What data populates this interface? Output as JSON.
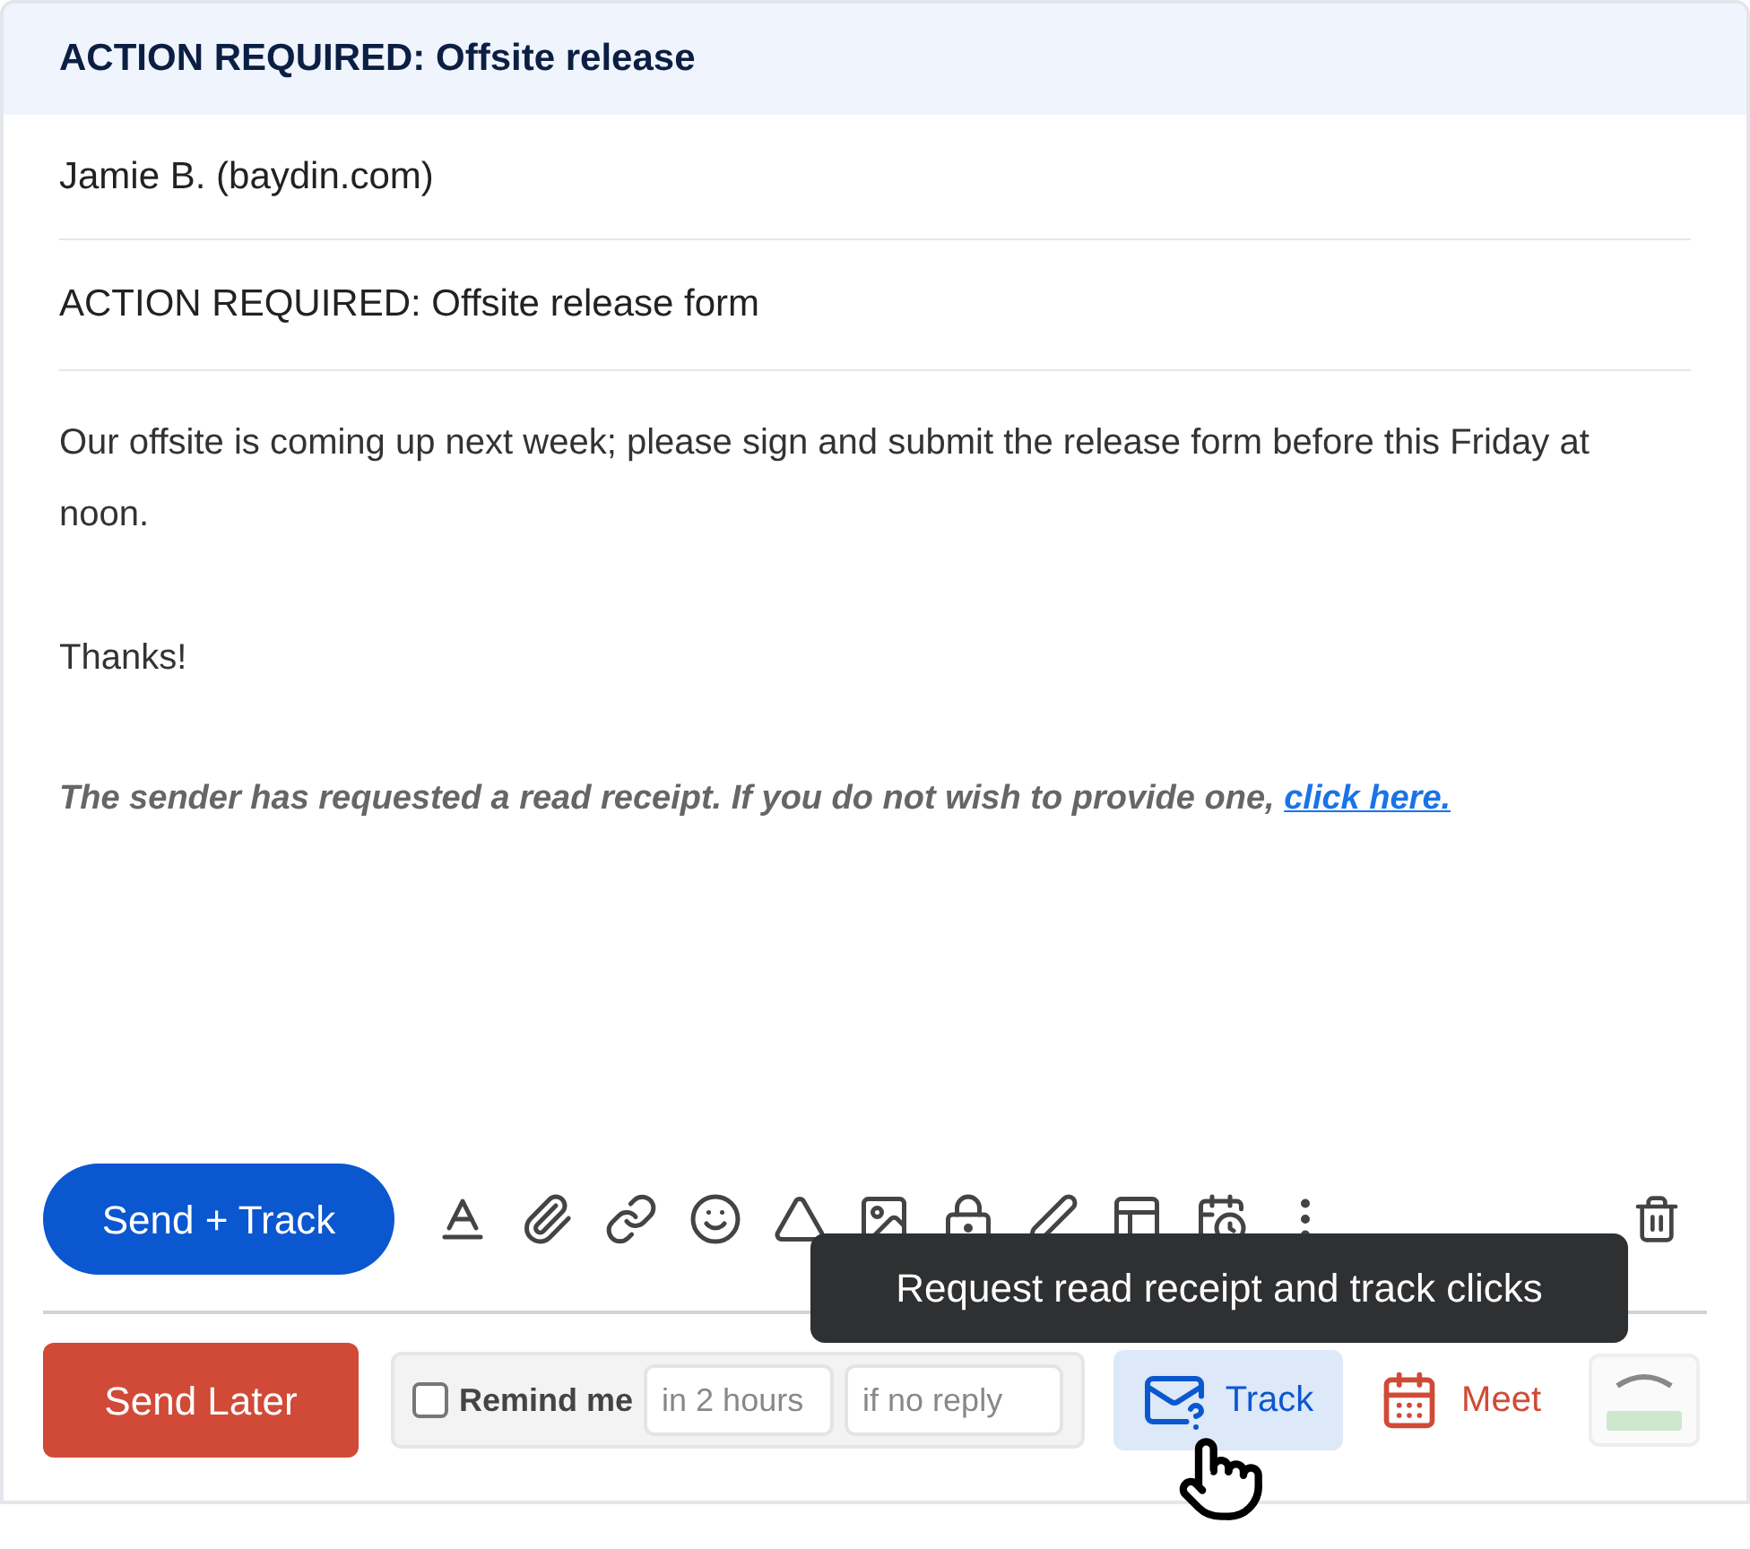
{
  "header": {
    "title": "ACTION REQUIRED: Offsite release"
  },
  "recipient": "Jamie B. (baydin.com)",
  "subject": "ACTION REQUIRED: Offsite release form",
  "body": {
    "paragraphs": [
      "Our offsite is coming up next week; please sign and submit the release form before this Friday at noon.",
      "Thanks!"
    ],
    "receipt_notice": {
      "text": "The sender has requested a read receipt. If you do not wish to provide one,",
      "link": "click here."
    }
  },
  "toolbar": {
    "send_button": "Send + Track"
  },
  "tooltip": "Request read receipt and track clicks",
  "bottom_bar": {
    "send_later": "Send Later",
    "remind": {
      "label": "Remind me",
      "checked": false,
      "when_placeholder": "in 2 hours",
      "condition_placeholder": "if no reply"
    },
    "track": {
      "label": "Track",
      "selected": true
    },
    "meet": "Meet"
  }
}
